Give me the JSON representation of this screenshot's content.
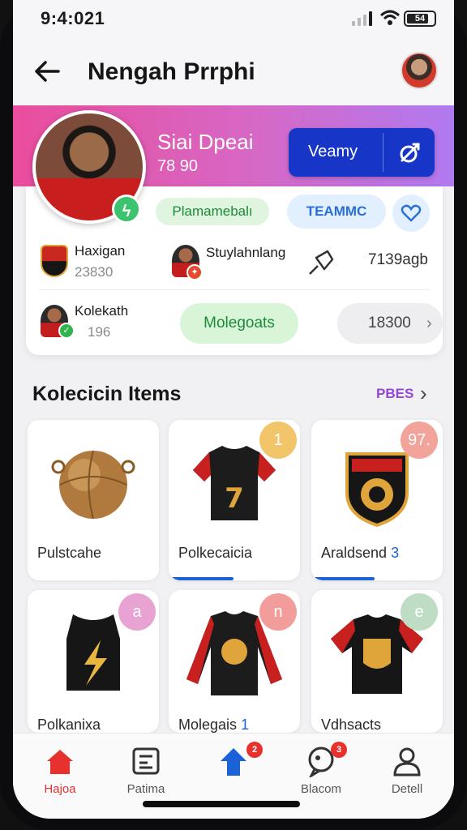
{
  "status": {
    "time": "9:4:021",
    "battery": "54"
  },
  "header": {
    "title": "Nengah Prrphi"
  },
  "profile": {
    "name": "Siai Dpeai",
    "number": "78 90",
    "action_label": "Veamy",
    "rank_pill": "Plamamebalı",
    "team_pill": "TEAMMC"
  },
  "stats": [
    {
      "name": "Haxigan",
      "value": "23830"
    },
    {
      "name": "Stuylahnlang",
      "value": ""
    },
    {
      "name": "Kolekath",
      "value": "196"
    }
  ],
  "stat_right": "7139agb",
  "buttons": {
    "green": "Molegoats",
    "grey": "18300"
  },
  "section": {
    "title": "Kolecicin Items",
    "link": "PBES"
  },
  "items": [
    {
      "label": "Pulstcahe",
      "badge": ""
    },
    {
      "label": "Polkecaicia",
      "badge": "1"
    },
    {
      "label": "Araldsend",
      "accent": "3",
      "badge": "97."
    },
    {
      "label": "Polkanixa",
      "badge": "a"
    },
    {
      "label": "Molegais",
      "accent": "1",
      "badge": "n"
    },
    {
      "label": "Vdhsacts",
      "badge": "e"
    }
  ],
  "nav": [
    {
      "label": "Hajoa",
      "icon": "home-icon"
    },
    {
      "label": "Patima",
      "icon": "collection-icon"
    },
    {
      "label": "",
      "icon": "upload-icon",
      "badge": "2"
    },
    {
      "label": "Blacom",
      "icon": "chat-icon",
      "badge": "3"
    },
    {
      "label": "Detell",
      "icon": "profile-icon"
    }
  ],
  "colors": {
    "banner_start": "#ea4d9c",
    "banner_end": "#b07af0",
    "primary_blue": "#1736c8",
    "accent_green": "#3cc36e",
    "active_red": "#e6312f"
  }
}
